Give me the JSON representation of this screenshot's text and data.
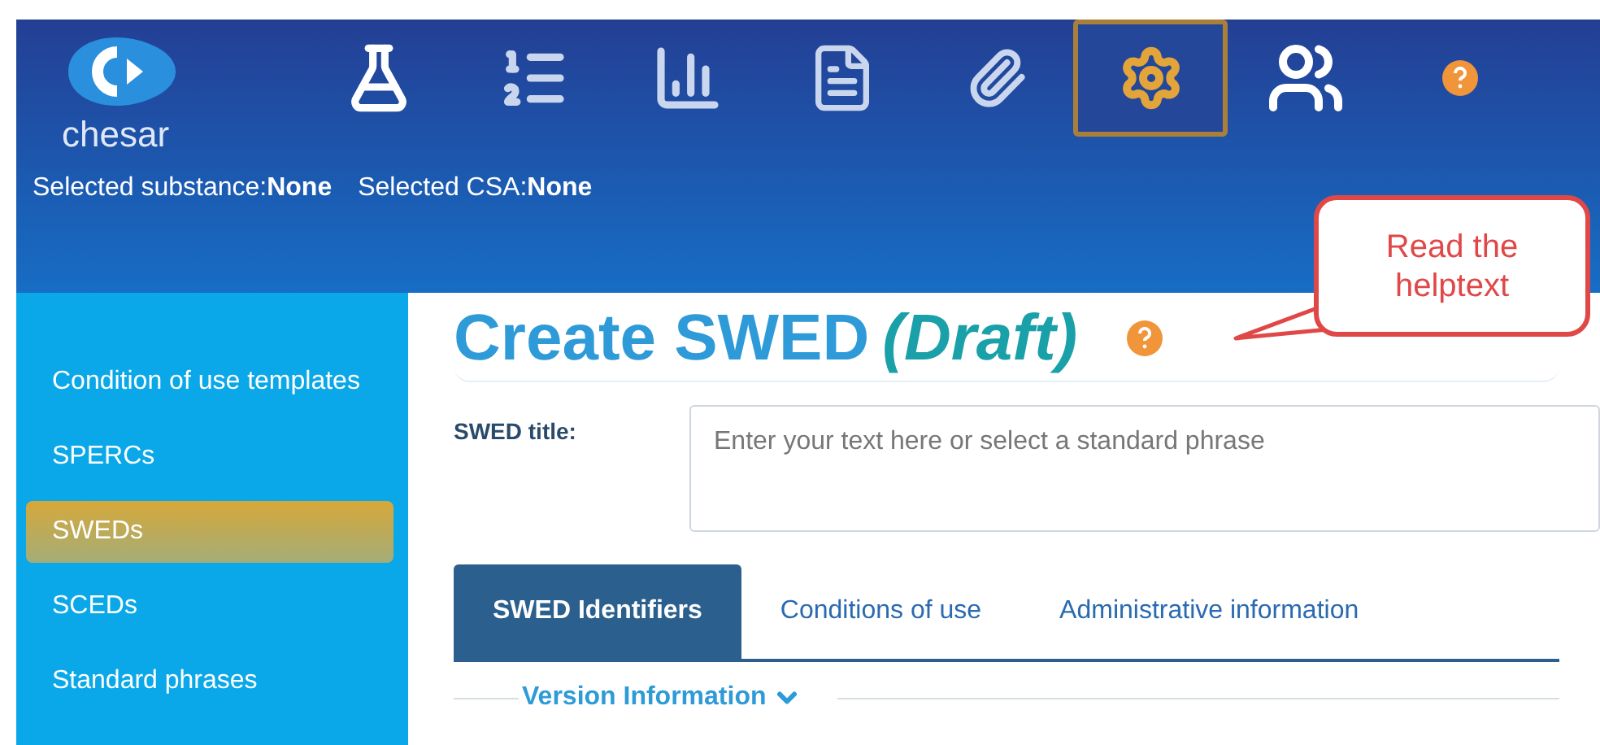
{
  "header": {
    "logo_text": "chesar",
    "selected_substance": "Selected substance:**None**",
    "selected_csa": "Selected CSA:**None**"
  },
  "nav_items": [
    {
      "kind": "flask",
      "selected": false
    },
    {
      "kind": "list",
      "selected": false
    },
    {
      "kind": "chart",
      "selected": false
    },
    {
      "kind": "document",
      "selected": false
    },
    {
      "kind": "paperclip",
      "selected": false
    },
    {
      "kind": "gear",
      "selected": true
    },
    {
      "kind": "users",
      "selected": false
    },
    {
      "kind": "help",
      "selected": false
    }
  ],
  "sidebar": {
    "items": [
      {
        "label": "Condition of use templates",
        "selected": false
      },
      {
        "label": "SPERCs",
        "selected": false
      },
      {
        "label": "SWEDs",
        "selected": true
      },
      {
        "label": "SCEDs",
        "selected": false
      },
      {
        "label": "Standard phrases",
        "selected": false
      }
    ]
  },
  "page": {
    "title": "Create SWED",
    "status": "(Draft)",
    "title_field": {
      "label": "SWED title:",
      "placeholder": "Enter your text here or select a standard phrase"
    },
    "tabs": [
      {
        "label": "SWED Identifiers",
        "selected": true
      },
      {
        "label": "Conditions of use",
        "selected": false
      },
      {
        "label": "Administrative information",
        "selected": false
      }
    ],
    "section": {
      "label": "Version Information",
      "expanded": true
    }
  },
  "callout": {
    "text": "Read the helptext"
  }
}
